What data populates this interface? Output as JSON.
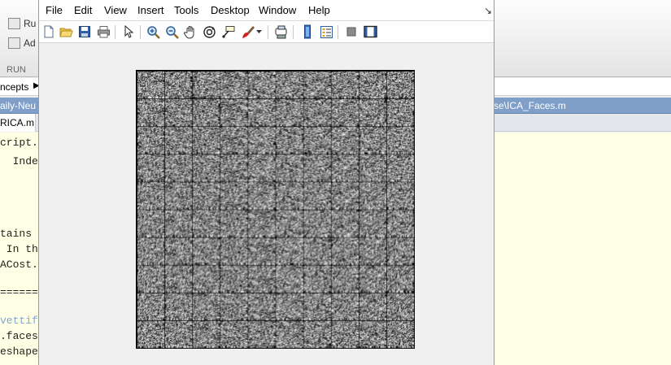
{
  "background_editor": {
    "toolstrip": {
      "run_button_label": "Ru",
      "advance_button_label": "Ad",
      "section_label": "RUN"
    },
    "nav": {
      "section_label": "ncepts",
      "arrow": "▶"
    },
    "title_bar": {
      "path_left": "aily-Neu",
      "path_right": "se\\ICA_Faces.m"
    },
    "tab": {
      "label": "RICA.m"
    },
    "code_lines": [
      {
        "text": "cript. For",
        "style": "normal"
      },
      {
        "text": "  Indepe",
        "style": "normal"
      },
      {
        "text": "tains c",
        "style": "normal"
      },
      {
        "text": " In thi",
        "style": "normal"
      },
      {
        "text": "ACost.m",
        "style": "normal"
      },
      {
        "text": "=======",
        "style": "normal"
      },
      {
        "text": "vettif",
        "style": "link"
      },
      {
        "text": ".faces",
        "style": "normal"
      },
      {
        "text": "eshape",
        "style": "normal"
      }
    ]
  },
  "figure_window": {
    "menu": [
      "File",
      "Edit",
      "View",
      "Insert",
      "Tools",
      "Desktop",
      "Window",
      "Help"
    ],
    "dock_arrow": "↘",
    "toolbar_icons": [
      "new-figure-icon",
      "open-file-icon",
      "save-icon",
      "print-icon",
      "edit-plot-arrow-icon",
      "zoom-in-icon",
      "zoom-out-icon",
      "pan-hand-icon",
      "rotate-3d-icon",
      "data-cursor-icon",
      "brush-icon",
      "brush-dropdown-icon",
      "link-plot-icon",
      "insert-colorbar-icon",
      "insert-legend-icon",
      "hide-plot-tools-icon",
      "show-plot-tools-icon"
    ],
    "axes": {
      "type": "image-grid",
      "rows": 10,
      "cols": 10,
      "tile_pixels": 32,
      "colormap": "gray",
      "content": "learned ICA basis filters shown as noisy grayscale patches"
    }
  }
}
